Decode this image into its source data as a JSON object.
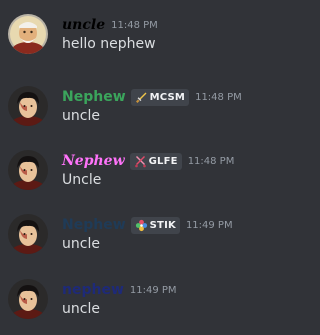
{
  "messages": [
    {
      "author": "uncle",
      "author_color": "#ffffff",
      "time": "11:48 PM",
      "text": "hello nephew",
      "avatar": "uncle-avatar"
    },
    {
      "author": "Nephew",
      "author_color": "#3ba55c",
      "tag": {
        "icon": "sword-icon",
        "label": "MCSM"
      },
      "time": "11:48 PM",
      "text": "uncle",
      "avatar": "nephew-avatar"
    },
    {
      "author": "Nephew",
      "author_color": "#ff73fa",
      "tag": {
        "icon": "crossed-swords-icon",
        "label": "GLFE"
      },
      "time": "11:48 PM",
      "text": "Uncle",
      "avatar": "nephew-avatar"
    },
    {
      "author": "Nephew",
      "author_color": "#1f3b57",
      "tag": {
        "icon": "clover-icon",
        "label": "STIK"
      },
      "time": "11:49 PM",
      "text": "uncle",
      "avatar": "nephew-avatar"
    },
    {
      "author": "nephew",
      "author_color": "#1e2a78",
      "time": "11:49 PM",
      "text": "uncle",
      "avatar": "nephew-avatar"
    }
  ]
}
